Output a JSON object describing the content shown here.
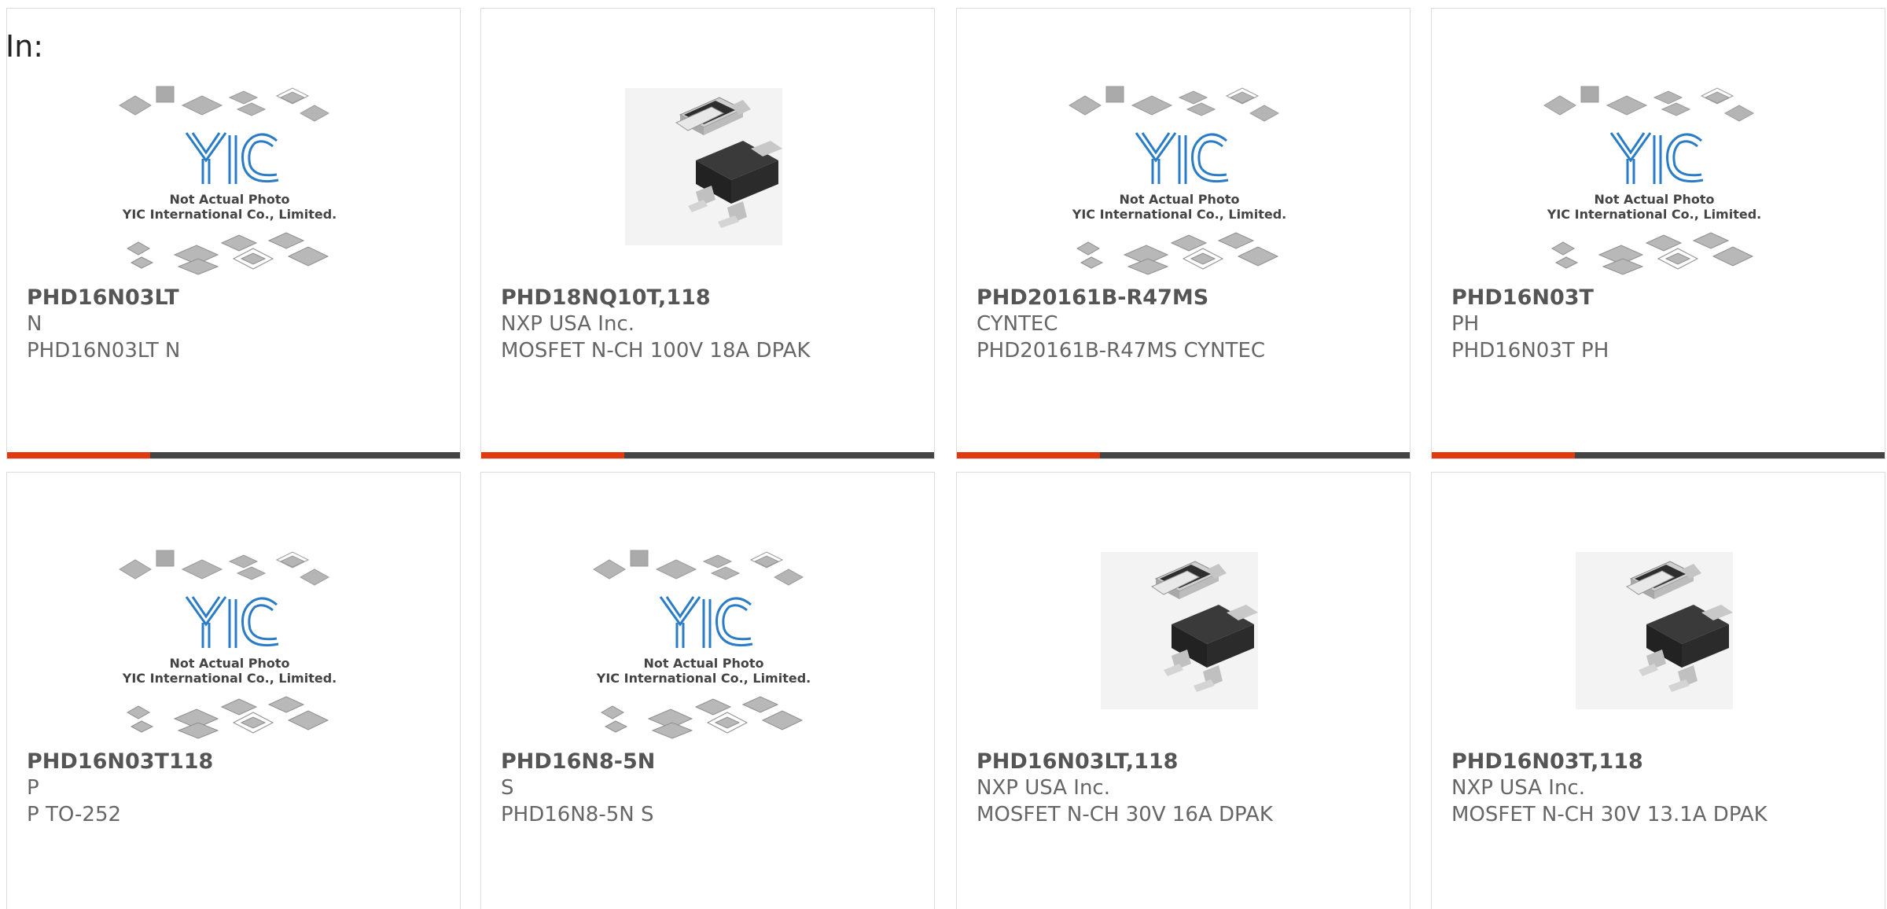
{
  "header": {
    "label": "In:"
  },
  "accent_color": "#e03a0e",
  "bar_color": "#444444",
  "placeholder": {
    "line1": "Not Actual Photo",
    "line2": "YIC International Co., Limited.",
    "logo_text": "YIC"
  },
  "products": [
    {
      "part": "PHD16N03LT",
      "maker": "N",
      "desc": "PHD16N03LT N",
      "image": "yic-placeholder"
    },
    {
      "part": "PHD18NQ10T,118",
      "maker": "NXP USA Inc.",
      "desc": "MOSFET N-CH 100V 18A DPAK",
      "image": "dpak-photo"
    },
    {
      "part": "PHD20161B-R47MS",
      "maker": "CYNTEC",
      "desc": "PHD20161B-R47MS CYNTEC",
      "image": "yic-placeholder"
    },
    {
      "part": "PHD16N03T",
      "maker": "PH",
      "desc": "PHD16N03T PH",
      "image": "yic-placeholder"
    },
    {
      "part": "PHD16N03T118",
      "maker": "P",
      "desc": "P TO-252",
      "image": "yic-placeholder"
    },
    {
      "part": "PHD16N8-5N",
      "maker": "S",
      "desc": "PHD16N8-5N S",
      "image": "yic-placeholder"
    },
    {
      "part": "PHD16N03LT,118",
      "maker": "NXP USA Inc.",
      "desc": "MOSFET N-CH 30V 16A DPAK",
      "image": "dpak-photo"
    },
    {
      "part": "PHD16N03T,118",
      "maker": "NXP USA Inc.",
      "desc": "MOSFET N-CH 30V 13.1A DPAK",
      "image": "dpak-photo"
    }
  ]
}
